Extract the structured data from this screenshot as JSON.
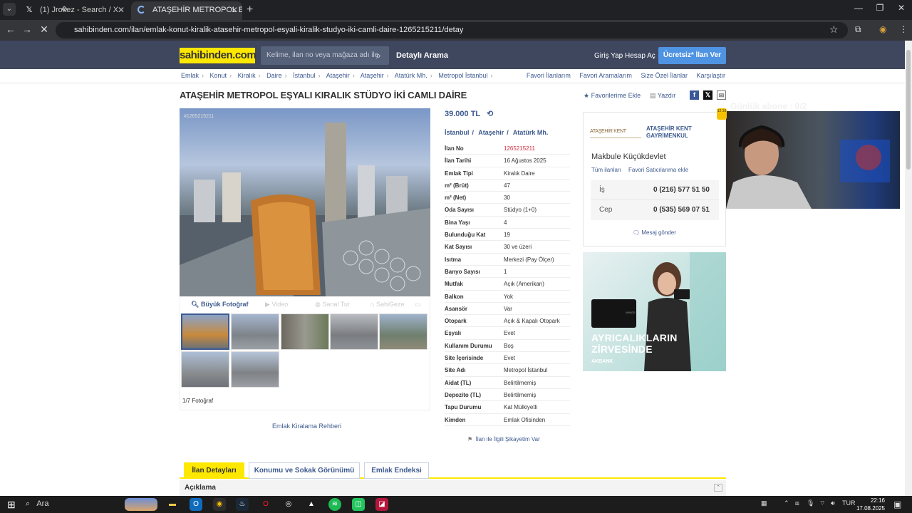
{
  "browser": {
    "tabs": [
      {
        "label": "(1) Jrokez - Search / X",
        "icon": "x-logo-icon"
      },
      {
        "label": "ATAŞEHİR METROPOL EŞYALI K",
        "icon": "loading-spinner-icon"
      }
    ],
    "url": "sahibinden.com/ilan/emlak-konut-kiralik-atasehir-metropol-esyali-kiralik-studyo-iki-camli-daire-1265215211/detay"
  },
  "header": {
    "logo": "sahibinden.com",
    "search_placeholder": "Kelime, ilan no veya mağaza adı ile ara",
    "advanced_search": "Detaylı Arama",
    "login": "Giriş Yap",
    "register": "Hesap Aç",
    "post_ad": "Ücretsiz* İlan Ver"
  },
  "breadcrumbs": [
    "Emlak",
    "Konut",
    "Kiralık",
    "Daire",
    "İstanbul",
    "Ataşehir",
    "Ataşehir",
    "Atatürk Mh.",
    "Metropol İstanbul"
  ],
  "right_links": [
    "Favori İlanlarım",
    "Favori Aramalarım",
    "Size Özel İlanlar",
    "Karşılaştır"
  ],
  "listing": {
    "title": "ATAŞEHİR METROPOL EŞYALI KIRALIK STÜDYO İKİ CAMLI DAİRE",
    "add_favorites": "Favorilerime Ekle",
    "print": "Yazdır",
    "photo_stamp": "#1265215211",
    "photo_actions": {
      "big_photo": "Büyük Fotoğraf",
      "video": "Video",
      "virtual_tour": "Sanal Tur",
      "sahigeze": "SahiGeze"
    },
    "photo_count": "1/7 Fotoğraf",
    "guide": "Emlak Kiralama Rehberi",
    "price": "39.000 TL",
    "location": [
      "İstanbul",
      "Ataşehir",
      "Atatürk Mh."
    ],
    "details": [
      {
        "k": "İlan No",
        "v": "1265215211"
      },
      {
        "k": "İlan Tarihi",
        "v": "16 Ağustos 2025"
      },
      {
        "k": "Emlak Tipi",
        "v": "Kiralık Daire"
      },
      {
        "k": "m² (Brüt)",
        "v": "47"
      },
      {
        "k": "m² (Net)",
        "v": "30"
      },
      {
        "k": "Oda Sayısı",
        "v": "Stüdyo (1+0)"
      },
      {
        "k": "Bina Yaşı",
        "v": "4"
      },
      {
        "k": "Bulunduğu Kat",
        "v": "19"
      },
      {
        "k": "Kat Sayısı",
        "v": "30 ve üzeri"
      },
      {
        "k": "Isıtma",
        "v": "Merkezi (Pay Ölçer)"
      },
      {
        "k": "Banyo Sayısı",
        "v": "1"
      },
      {
        "k": "Mutfak",
        "v": "Açık (Amerikan)"
      },
      {
        "k": "Balkon",
        "v": "Yok"
      },
      {
        "k": "Asansör",
        "v": "Var"
      },
      {
        "k": "Otopark",
        "v": "Açık & Kapalı Otopark"
      },
      {
        "k": "Eşyalı",
        "v": "Evet"
      },
      {
        "k": "Kullanım Durumu",
        "v": "Boş"
      },
      {
        "k": "Site İçerisinde",
        "v": "Evet"
      },
      {
        "k": "Site Adı",
        "v": "Metropol İstanbul"
      },
      {
        "k": "Aidat (TL)",
        "v": "Belirtilmemiş"
      },
      {
        "k": "Depozito (TL)",
        "v": "Belirtilmemiş"
      },
      {
        "k": "Tapu Durumu",
        "v": "Kat Mülkiyetli"
      },
      {
        "k": "Kimden",
        "v": "Emlak Ofisinden"
      }
    ],
    "complaint": "İlan ile İlgili Şikayetim Var"
  },
  "agency": {
    "logo_text": "ATAŞEHİR KENT",
    "name": "ATAŞEHİR KENT GAYRİMENKUL",
    "person": "Makbule Küçükdevlet",
    "all_listings": "Tüm ilanları",
    "fav_seller": "Favori Satıcılarıma ekle",
    "phones": [
      {
        "label": "İş",
        "number": "0 (216) 577 51 50"
      },
      {
        "label": "Cep",
        "number": "0 (535) 569 07 51"
      }
    ],
    "message": "Mesaj gönder"
  },
  "ad": {
    "headline_1": "AYRICALIKLARIN",
    "headline_2": "ZİRVESİNDE",
    "brand": "AKBANK",
    "card": "WINGS"
  },
  "overlay": {
    "label": "Günlük abone : 0/2",
    "badge": "12 16"
  },
  "detail_tabs": [
    "İlan Detayları",
    "Konumu ve Sokak Görünümü",
    "Emlak Endeksi"
  ],
  "description": {
    "title": "Açıklama"
  },
  "taskbar": {
    "search": "Ara",
    "lang": "TUR",
    "time": "22:16",
    "date": "17.08.2025"
  }
}
